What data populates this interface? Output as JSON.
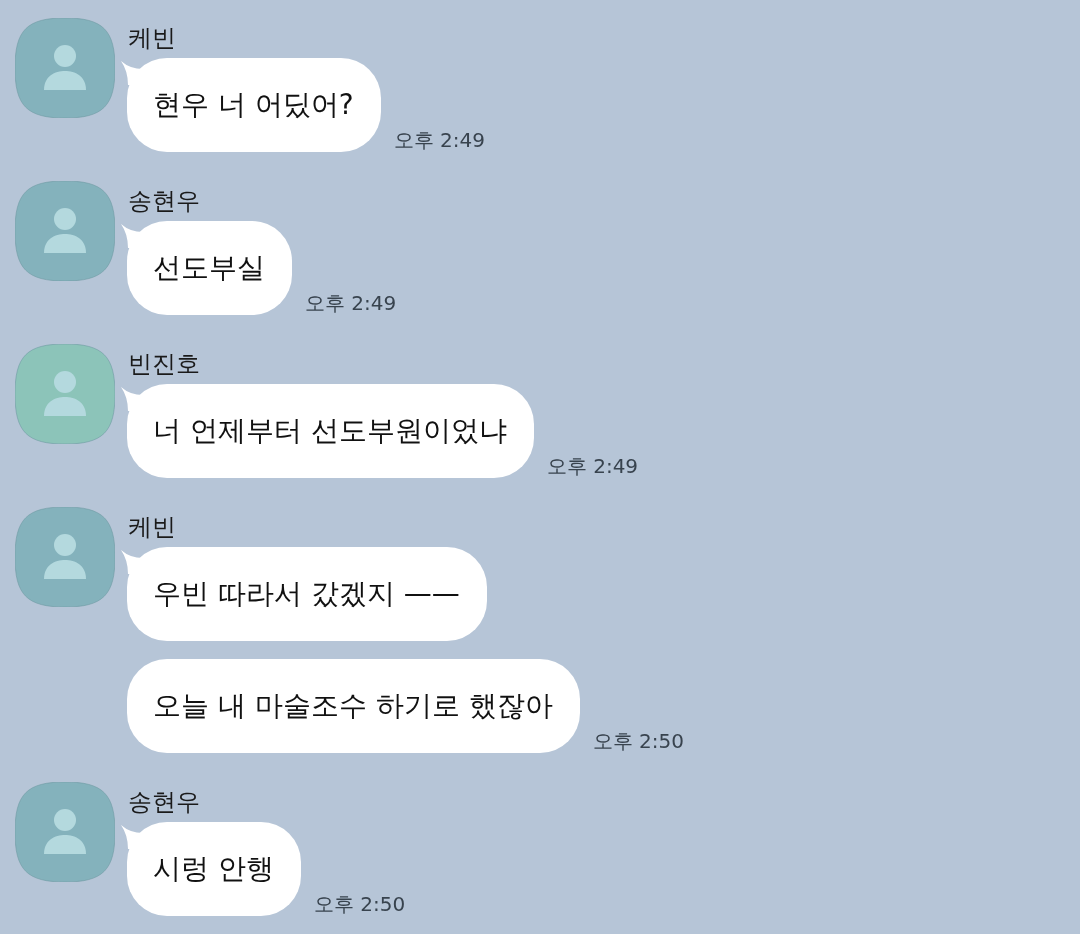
{
  "messages": [
    {
      "sender": "케빈",
      "color": "#84b2bc",
      "bubbles": [
        {
          "text": "현우 너 어딨어?",
          "time": "오후 2:49"
        }
      ]
    },
    {
      "sender": "송현우",
      "color": "#84b2bc",
      "bubbles": [
        {
          "text": "선도부실",
          "time": "오후 2:49"
        }
      ]
    },
    {
      "sender": "빈진호",
      "color": "#8cc4b9",
      "bubbles": [
        {
          "text": "너 언제부터 선도부원이었냐",
          "time": "오후 2:49"
        }
      ]
    },
    {
      "sender": "케빈",
      "color": "#84b2bc",
      "bubbles": [
        {
          "text": "우빈 따라서 갔겠지 ——"
        },
        {
          "text": "오늘 내 마술조수 하기로 했잖아",
          "time": "오후 2:50"
        }
      ]
    },
    {
      "sender": "송현우",
      "color": "#84b2bc",
      "bubbles": [
        {
          "text": "시렁 안행",
          "time": "오후 2:50"
        }
      ]
    }
  ]
}
